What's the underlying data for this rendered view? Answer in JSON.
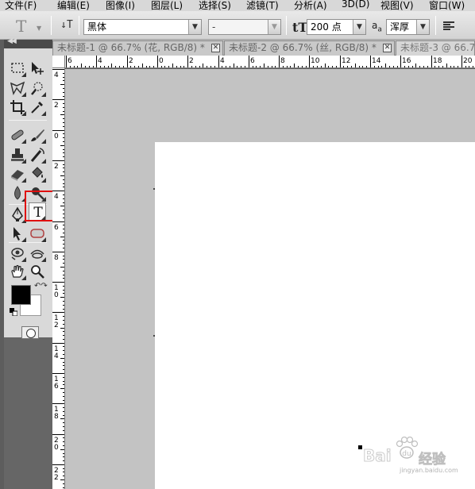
{
  "menu": {
    "items": [
      "文件(F)",
      "编辑(E)",
      "图像(I)",
      "图层(L)",
      "选择(S)",
      "滤镜(T)",
      "分析(A)",
      "3D(D)",
      "视图(V)",
      "窗口(W)"
    ]
  },
  "options_bar": {
    "tool_icon": "horizontal-type-tool-icon",
    "font_family": "黑体",
    "font_style": "-",
    "font_size": "200 点",
    "antialias_icon": "aa",
    "antialias": "浑厚"
  },
  "tabs": [
    {
      "title": "未标题-1 @ 66.7% (花, RGB/8) *",
      "close": "✕"
    },
    {
      "title": "未标题-2 @ 66.7% (丝, RGB/8) *",
      "close": "✕"
    },
    {
      "title": "未标题-3 @ 66.7%",
      "close": ""
    }
  ],
  "ruler": {
    "top_labels": [
      "6",
      "4",
      "2",
      "0",
      "2",
      "4",
      "6",
      "8",
      "10",
      "12",
      "14",
      "16",
      "18",
      "20"
    ],
    "left_labels": [
      "4",
      "2",
      "0",
      "2",
      "4",
      "6",
      "8",
      "1\n0",
      "1\n2",
      "1\n4",
      "1\n6",
      "1\n8",
      "2\n0",
      "2\n2"
    ]
  },
  "tools": {
    "highlighted": "type-tool",
    "highlight_color": "#e01010"
  },
  "colors": {
    "foreground": "#000000",
    "background": "#ffffff"
  },
  "watermark": {
    "brand": "Bai",
    "brand_suffix": "经验",
    "url": "jingyan.baidu.com"
  }
}
